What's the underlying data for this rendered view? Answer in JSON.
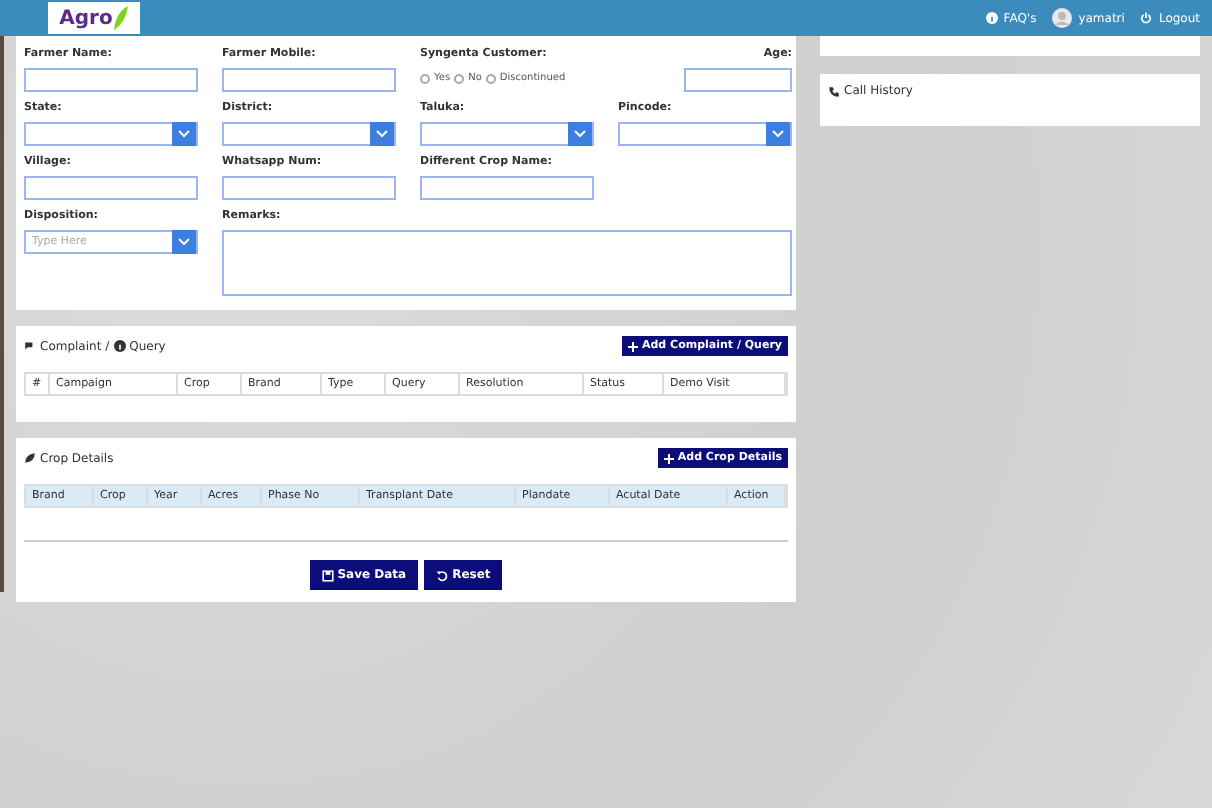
{
  "header": {
    "logo": "Agro",
    "links": [
      {
        "kind": "faq",
        "label": "FAQ's"
      },
      {
        "kind": "user",
        "label": "yamatri"
      },
      {
        "kind": "logout",
        "label": "Logout"
      }
    ]
  },
  "form": {
    "fields": [
      {
        "kind": "text",
        "label": "Farmer Name:"
      },
      {
        "kind": "text",
        "label": "Farmer Mobile:"
      },
      {
        "kind": "radio",
        "label": "Syngenta Customer:",
        "options": [
          {
            "label": "Yes",
            "selected": false
          },
          {
            "label": "No",
            "selected": false
          },
          {
            "label": "Discontinued",
            "selected": false
          }
        ]
      },
      {
        "kind": "short",
        "label": "Age:"
      },
      {
        "kind": "select",
        "label": "State:"
      },
      {
        "kind": "select",
        "label": "District:"
      },
      {
        "kind": "select",
        "label": "Taluka:"
      },
      {
        "kind": "select",
        "label": "Pincode:"
      },
      {
        "kind": "text",
        "label": "Village:"
      },
      {
        "kind": "text",
        "label": "Whatsapp Num:"
      },
      {
        "kind": "text",
        "label": "Different Crop Name:"
      },
      {
        "kind": "blank"
      },
      {
        "kind": "select",
        "label": "Disposition:",
        "placeholder": "Type Here"
      },
      {
        "kind": "textarea",
        "label": "Remarks:"
      }
    ]
  },
  "panels": [
    {
      "kind": "complaint",
      "title": "Complaint / ",
      "title_2": "Query",
      "button": "Add Complaint / Query",
      "header_shaded": false,
      "columns": [
        "#",
        "Campaign",
        "Crop",
        "Brand",
        "Type",
        "Query",
        "Resolution",
        "Status",
        "Demo Visit"
      ]
    },
    {
      "kind": "crop",
      "title": "Crop Details",
      "button": "Add Crop Details",
      "header_shaded": true,
      "columns": [
        "Brand",
        "Crop",
        "Year",
        "Acres",
        "Phase No",
        "Transplant Date",
        "Plandate",
        "Acutal Date",
        "Action"
      ]
    }
  ],
  "actions": [
    {
      "kind": "save",
      "label": "Save Data"
    },
    {
      "kind": "reset",
      "label": "Reset"
    }
  ],
  "side": {
    "call_history": "Call History"
  }
}
